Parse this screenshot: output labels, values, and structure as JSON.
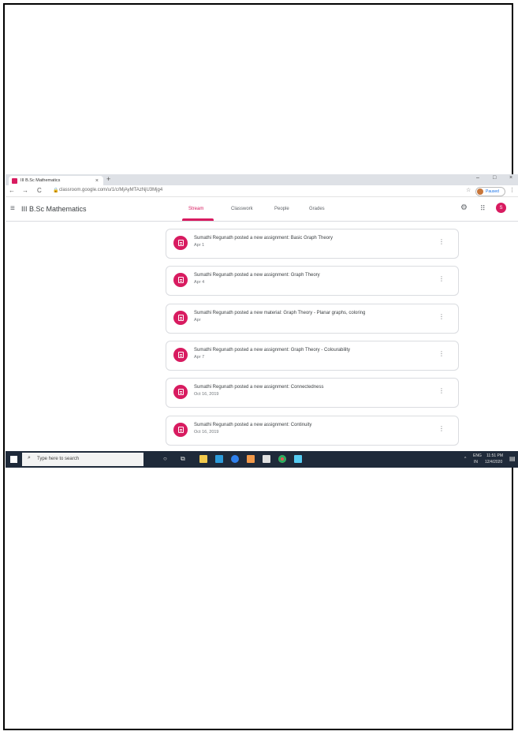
{
  "browser": {
    "tab_title": "III B.Sc Mathematics",
    "new_tab": "+",
    "url": "classroom.google.com/u/1/c/MjAyMTAzNjU3Mjg4",
    "profile_label": "Paused",
    "nav_back": "←",
    "nav_forward": "→",
    "nav_reload": "C",
    "window_min": "–",
    "window_max": "□",
    "window_close": "×"
  },
  "classroom": {
    "class_title": "III B.Sc Mathematics",
    "tabs": [
      "Stream",
      "Classwork",
      "People",
      "Grades"
    ],
    "active_tab": "Stream",
    "avatar_letter": "S",
    "accent_color": "#d81b60"
  },
  "stream": {
    "posts": [
      {
        "title": "Sumathi Regunath posted a new assignment: Basic Graph Theory",
        "date": "Apr 1"
      },
      {
        "title": "Sumathi Regunath posted a new assignment: Graph Theory",
        "date": "Apr 4"
      },
      {
        "title": "Sumathi Regunath posted a new material: Graph Theory - Planar graphs, coloring",
        "date": "Apr"
      },
      {
        "title": "Sumathi Regunath posted a new assignment: Graph Theory - Colourability",
        "date": "Apr 7"
      },
      {
        "title": "Sumathi Regunath posted a new assignment: Connectedness",
        "date": "Oct 16, 2019"
      },
      {
        "title": "Sumathi Regunath posted a new assignment: Continuity",
        "date": "Oct 16, 2019"
      }
    ]
  },
  "taskbar": {
    "search_placeholder": "Type here to search",
    "tray_lang": "ENG",
    "tray_region": "IN",
    "time": "11:51 PM",
    "date": "12/4/2020"
  },
  "icons": {
    "hamburger": "menu-icon",
    "settings": "gear-icon",
    "apps": "apps-grid-icon",
    "more": "more-vert-icon",
    "help": "help-icon"
  }
}
